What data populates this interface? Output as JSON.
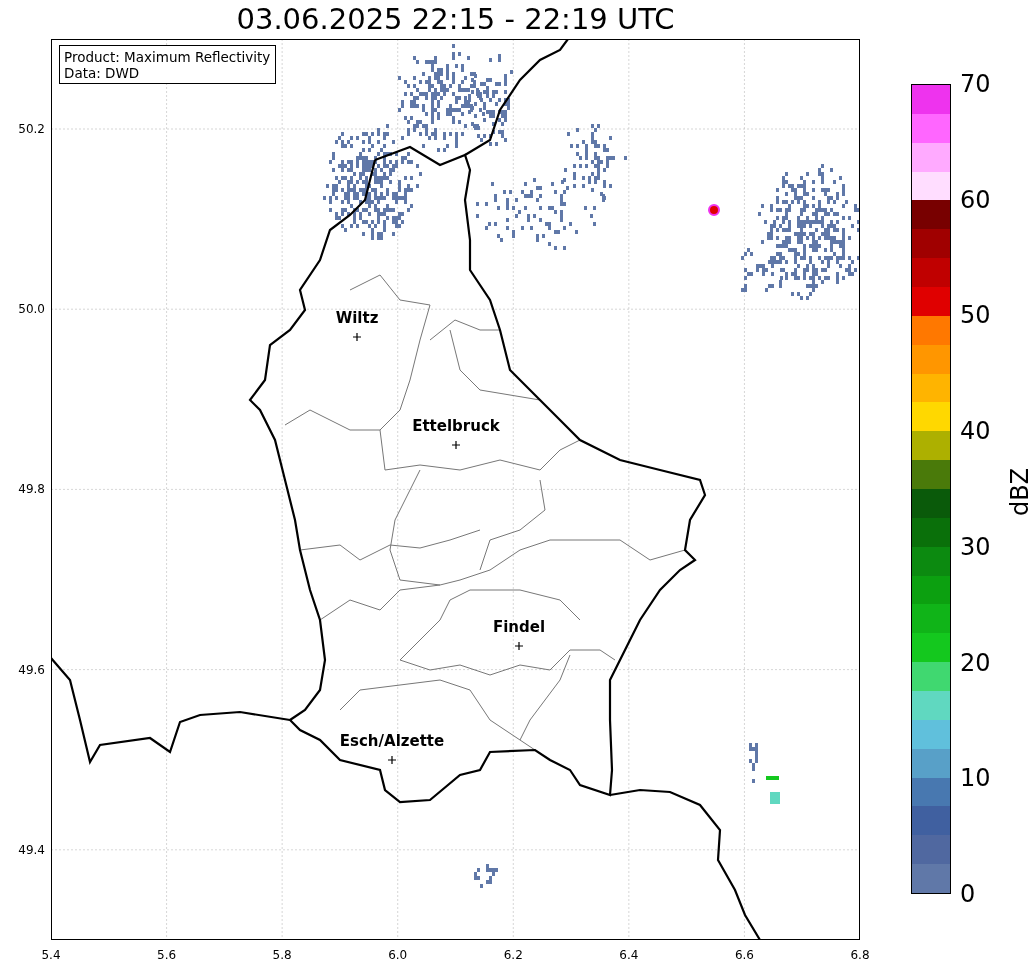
{
  "title": "03.06.2025 22:15 - 22:19 UTC",
  "info_box": [
    "Product: Maximum Reflectivity",
    "Data: DWD"
  ],
  "cities": [
    {
      "name": "Wiltz"
    },
    {
      "name": "Ettelbruck"
    },
    {
      "name": "Findel"
    },
    {
      "name": "Esch/Alzette"
    }
  ],
  "x_ticks": [
    "5.4",
    "5.6",
    "5.8",
    "6.0",
    "6.2",
    "6.4",
    "6.6",
    "6.8"
  ],
  "y_ticks": [
    "50.2",
    "50.0",
    "49.8",
    "49.6",
    "49.4"
  ],
  "colorbar": {
    "label": "dBZ",
    "ticks": [
      "70",
      "60",
      "50",
      "40",
      "30",
      "20",
      "10",
      "0"
    ],
    "segments": [
      {
        "color": "#ee33ee"
      },
      {
        "color": "#ff66ff"
      },
      {
        "color": "#ffaaff"
      },
      {
        "color": "#ffddff"
      },
      {
        "color": "#780000"
      },
      {
        "color": "#a00000"
      },
      {
        "color": "#c00000"
      },
      {
        "color": "#e00000"
      },
      {
        "color": "#ff7800"
      },
      {
        "color": "#ff9600"
      },
      {
        "color": "#ffb400"
      },
      {
        "color": "#ffd800"
      },
      {
        "color": "#adb000"
      },
      {
        "color": "#4a7a0a"
      },
      {
        "color": "#0a5a0a"
      },
      {
        "color": "#0a700a"
      },
      {
        "color": "#0c8a10"
      },
      {
        "color": "#0ca010"
      },
      {
        "color": "#10b418"
      },
      {
        "color": "#14c81e"
      },
      {
        "color": "#40d870"
      },
      {
        "color": "#60d8c0"
      },
      {
        "color": "#60c0dc"
      },
      {
        "color": "#58a0c8"
      },
      {
        "color": "#4878b0"
      },
      {
        "color": "#4060a0"
      },
      {
        "color": "#5068a0"
      },
      {
        "color": "#6078a8"
      }
    ]
  }
}
